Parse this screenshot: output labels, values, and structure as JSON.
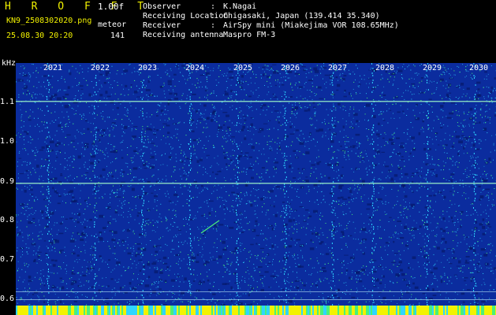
{
  "header": {
    "title": "H R O F F T",
    "version": "1.00f",
    "filename": "KN9_2508302020.png",
    "meteor_label": "meteor",
    "timestamp": "25.08.30 20:20",
    "meteor_count": "141"
  },
  "info": [
    {
      "key": "Observer",
      "sep": ":",
      "value": "K.Nagai"
    },
    {
      "key": "Receiving Location",
      "sep": ":",
      "value": "Chigasaki, Japan (139.414 35.340)"
    },
    {
      "key": "Receiver",
      "sep": ":",
      "value": "AirSpy mini (Miakejima VOR 108.65MHz)"
    },
    {
      "key": "Receiving antenna",
      "sep": ":",
      "value": "Maspro FM-3"
    }
  ],
  "spectrogram": {
    "unit_label": "kHz",
    "time_labels": [
      "2021",
      "2022",
      "2023",
      "2024",
      "2025",
      "2026",
      "2027",
      "2028",
      "2029",
      "2030"
    ],
    "freq_labels": [
      "1.1",
      "1.0",
      "0.9",
      "0.8",
      "0.7",
      "0.6"
    ],
    "colors": {
      "background": "#0b2c9e",
      "noise_dark": "#05186a",
      "noise_cyan": "#2fd6ff",
      "noise_green": "#4af07a",
      "noise_yellow": "#f2f200",
      "carrier_line": "#9ef7c8"
    }
  }
}
